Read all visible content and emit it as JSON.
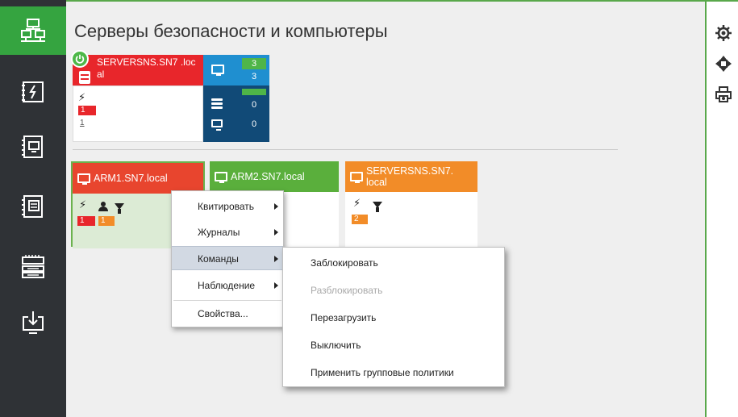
{
  "sidebar": {
    "items": [
      {
        "icon": "network-servers-icon",
        "active": true
      },
      {
        "icon": "events-log-icon"
      },
      {
        "icon": "computer-card-icon"
      },
      {
        "icon": "server-card-icon"
      },
      {
        "icon": "rack-devices-icon"
      },
      {
        "icon": "download-monitor-icon"
      }
    ]
  },
  "main": {
    "title": "Серверы безопасности и компьютеры"
  },
  "server": {
    "name": "SERVERSNS.SN7 .local",
    "stat_red": "1",
    "stat_plain": "1",
    "computers_total": "3",
    "computers_online": "3",
    "servers_count": "0",
    "monitors_count": "0"
  },
  "computers": [
    {
      "name": "ARM1.SN7.local",
      "color": "#e8452e",
      "stat_red": "1",
      "stat_orange": "1"
    },
    {
      "name": "ARM2.SN7.local",
      "color": "#5aaf3c"
    },
    {
      "name": "SERVERSNS.SN7. local",
      "color": "#f28c28",
      "stat_orange": "2"
    }
  ],
  "context_menu": {
    "items": [
      "Квитировать",
      "Журналы",
      "Команды",
      "Наблюдение",
      "Свойства..."
    ]
  },
  "submenu": {
    "items": [
      "Заблокировать",
      "Разблокировать",
      "Перезагрузить",
      "Выключить",
      "Применить групповые политики"
    ]
  },
  "colors": {
    "accent_green": "#35a440",
    "danger_red": "#e8262b",
    "warning_orange": "#f28c28",
    "info_blue": "#1f8fd0",
    "navy": "#114a77"
  },
  "right_toolbar": [
    "gear-icon",
    "move-arrows-icon",
    "printer-icon"
  ]
}
